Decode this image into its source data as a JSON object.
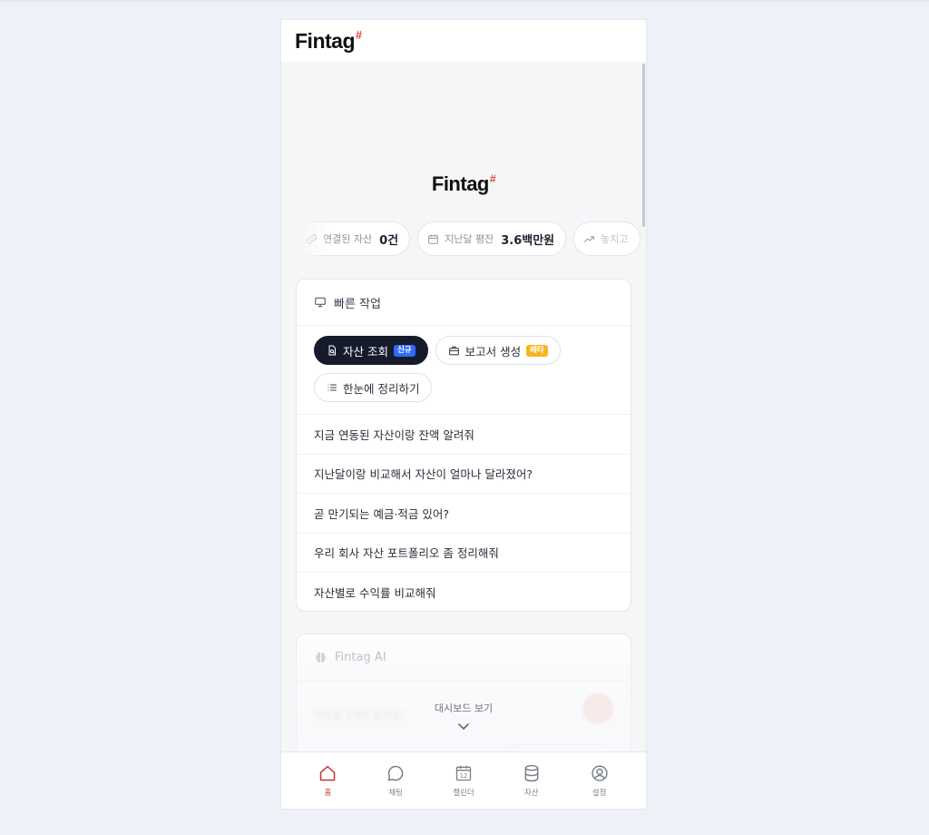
{
  "app": {
    "logo_text": "Fintag",
    "logo_mark": "#"
  },
  "colors": {
    "accent": "#c4342a",
    "logo_mark": "#e0453a",
    "active_chip": "#161b2c",
    "badge_new": "#2f6bff",
    "badge_beta": "#f5b51f"
  },
  "stats": [
    {
      "icon": "link-icon",
      "label": "연결된 자산",
      "value": "0건"
    },
    {
      "icon": "calendar-icon",
      "label": "지난달 평잔",
      "value": "3.6백만원"
    },
    {
      "icon": "trend-up-icon",
      "label": "놓치고",
      "value": ""
    }
  ],
  "quick": {
    "title": "빠른 작업",
    "icon": "monitor-icon",
    "chips": [
      {
        "label": "자산 조회",
        "badge": "신규",
        "icon": "document-search-icon",
        "active": true
      },
      {
        "label": "보고서 생성",
        "badge": "베타",
        "icon": "briefcase-icon",
        "active": false
      },
      {
        "label": "한눈에 정리하기",
        "badge": "",
        "icon": "list-icon",
        "active": false
      }
    ],
    "prompts": [
      "지금 연동된 자산이랑 잔액 알려줘",
      "지난달이랑 비교해서 자산이 얼마나 달라졌어?",
      "곧 만기되는 예금·적금 있어?",
      "우리 회사 자산 포트폴리오 좀 정리해줘",
      "자산별로 수익률 비교해줘"
    ]
  },
  "ai": {
    "title": "Fintag AI",
    "icon": "brain-icon",
    "placeholder": "무엇을 도와드릴까요?"
  },
  "dashboard": {
    "label": "대시보드 보기",
    "icon": "chevron-down-icon"
  },
  "tabs": [
    {
      "label": "홈",
      "icon": "home-icon",
      "active": true
    },
    {
      "label": "채팅",
      "icon": "chat-icon",
      "active": false
    },
    {
      "label": "캘린더",
      "icon": "calendar-icon",
      "day": "12",
      "active": false
    },
    {
      "label": "자산",
      "icon": "database-icon",
      "active": false
    },
    {
      "label": "설정",
      "icon": "user-circle-icon",
      "active": false
    }
  ]
}
